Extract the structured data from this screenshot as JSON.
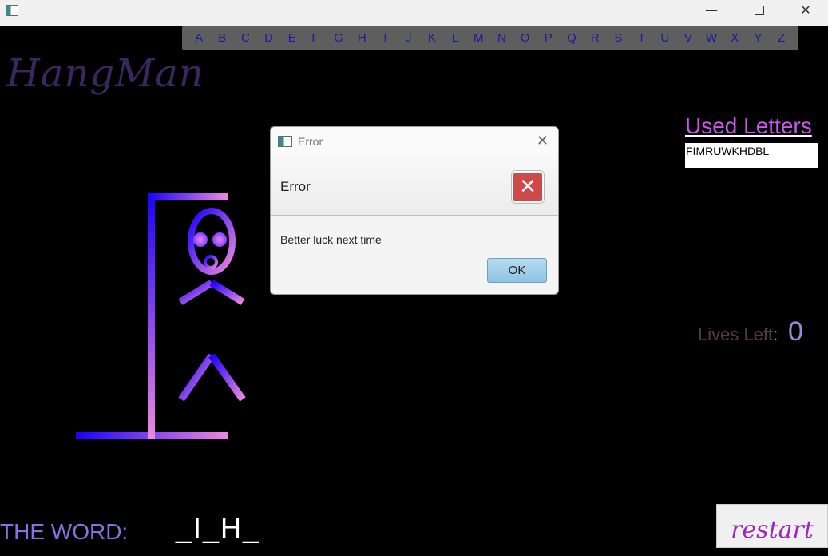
{
  "window": {
    "app_icon": "app-window-icon"
  },
  "letters": [
    "A",
    "B",
    "C",
    "D",
    "E",
    "F",
    "G",
    "H",
    "I",
    "J",
    "K",
    "L",
    "M",
    "N",
    "O",
    "P",
    "Q",
    "R",
    "S",
    "T",
    "U",
    "V",
    "W",
    "X",
    "Y",
    "Z"
  ],
  "game": {
    "title": "HangMan",
    "used_letters_title": "Used Letters",
    "used_letters": "FIMRUWKHDBL",
    "lives_label": "Lives Left",
    "lives_colon": ":",
    "lives_value": "0",
    "word_label": "THE WORD:",
    "word_value": "_I_H_",
    "restart_label": "restart"
  },
  "dialog": {
    "title": "Error",
    "header": "Error",
    "message": "Better luck next time",
    "ok_label": "OK",
    "icon": "error-icon"
  },
  "colors": {
    "background": "#000000",
    "gradient_start": "#1a00ff",
    "gradient_end": "#ee88dd",
    "letter_bar": "#5e5e5e"
  }
}
